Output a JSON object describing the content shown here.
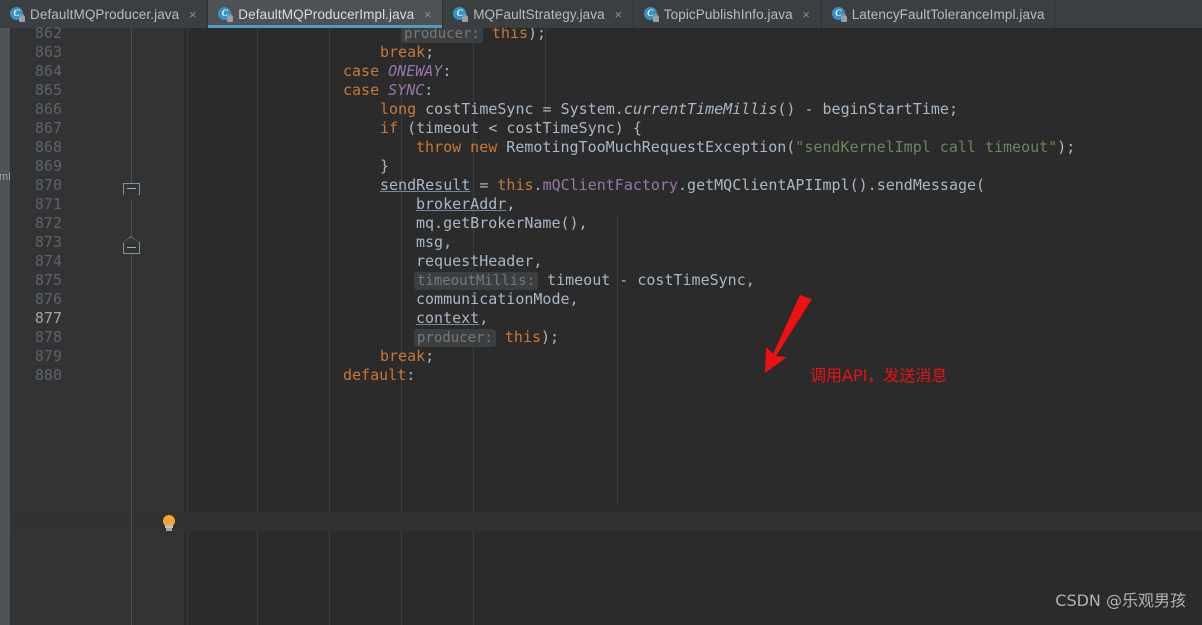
{
  "window": {
    "app": "IntelliJ IDEA Editor",
    "background": "#2b2b2b"
  },
  "tabs": {
    "icon_letter": "C",
    "close_glyph": "×",
    "items": [
      {
        "label": "DefaultMQProducer.java",
        "active": false,
        "icon": "java-class-icon",
        "closable": true
      },
      {
        "label": "DefaultMQProducerImpl.java",
        "active": true,
        "icon": "java-class-icon",
        "closable": true
      },
      {
        "label": "MQFaultStrategy.java",
        "active": false,
        "icon": "java-class-icon",
        "closable": true
      },
      {
        "label": "TopicPublishInfo.java",
        "active": false,
        "icon": "java-class-icon",
        "closable": true
      },
      {
        "label": "LatencyFaultToleranceImpl.java",
        "active": false,
        "icon": "java-class-icon",
        "closable": false
      }
    ]
  },
  "left_strip": {
    "name": "collapsed-tool-window-strip",
    "visible_text": "mBBFCRSST"
  },
  "gutter": {
    "line_numbers": [
      "862",
      "863",
      "864",
      "865",
      "866",
      "867",
      "868",
      "869",
      "870",
      "871",
      "872",
      "873",
      "874",
      "875",
      "876",
      "877",
      "878",
      "879",
      "880"
    ],
    "current_line": "877",
    "fold_markers": [
      {
        "line": "867",
        "type": "fold-collapse-start",
        "glyph": "minus"
      },
      {
        "line": "869",
        "type": "fold-collapse-end",
        "glyph": "minus"
      }
    ],
    "intention_bulb": {
      "line": "877",
      "icon": "lightbulb-icon",
      "color": "#f0a732"
    }
  },
  "editor": {
    "language": "java",
    "colors": {
      "background": "#2b2b2b",
      "gutter_background": "#313335",
      "caret_line": "#323232",
      "text": "#a9b7c6",
      "keyword": "#cc7832",
      "constant": "#9876aa",
      "string": "#6a8759",
      "field": "#9876aa",
      "line_number": "#606366",
      "indent_guide": "#3b3e40",
      "param_hint_bg": "#3c3f41",
      "param_hint_text": "#787878"
    },
    "lines": [
      {
        "num": "862",
        "text": "                producer: this);",
        "clipped": true
      },
      {
        "num": "863",
        "text": "                break;"
      },
      {
        "num": "864",
        "text": "            case ONEWAY:"
      },
      {
        "num": "865",
        "text": "            case SYNC:"
      },
      {
        "num": "866",
        "text": "                long costTimeSync = System.currentTimeMillis() - beginStartTime;"
      },
      {
        "num": "867",
        "text": "                if (timeout < costTimeSync) {"
      },
      {
        "num": "868",
        "text": "                    throw new RemotingTooMuchRequestException(\"sendKernelImpl call timeout\");"
      },
      {
        "num": "869",
        "text": "                }"
      },
      {
        "num": "870",
        "text": "                sendResult = this.mQClientFactory.getMQClientAPIImpl().sendMessage("
      },
      {
        "num": "871",
        "text": "                    brokerAddr,"
      },
      {
        "num": "872",
        "text": "                    mq.getBrokerName(),"
      },
      {
        "num": "873",
        "text": "                    msg,"
      },
      {
        "num": "874",
        "text": "                    requestHeader,"
      },
      {
        "num": "875",
        "text": "                    timeoutMillis: timeout - costTimeSync,"
      },
      {
        "num": "876",
        "text": "                    communicationMode,"
      },
      {
        "num": "877",
        "text": "                    context,"
      },
      {
        "num": "878",
        "text": "                    producer: this);"
      },
      {
        "num": "879",
        "text": "                break;"
      },
      {
        "num": "880",
        "text": "            default:"
      }
    ],
    "param_hints": [
      "timeoutMillis:",
      "producer:"
    ],
    "string_literals": [
      "sendKernelImpl call timeout"
    ]
  },
  "annotation": {
    "text": "调用API，发送消息",
    "color": "#ee1111",
    "arrow": "red-arrow-up-left"
  },
  "watermark": {
    "text": "CSDN @乐观男孩"
  }
}
